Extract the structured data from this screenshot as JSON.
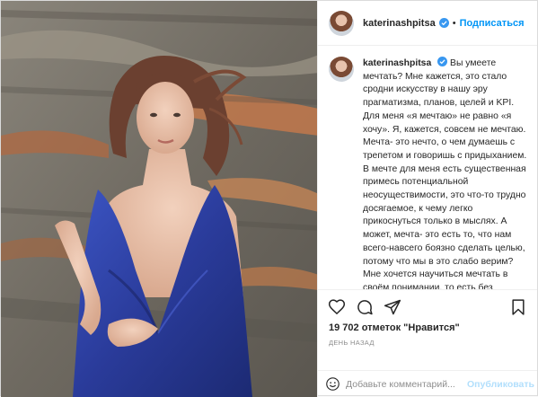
{
  "post": {
    "author": {
      "username": "katerinashpitsa",
      "verified": true,
      "follow_label": "Подписаться",
      "separator": "•"
    },
    "caption": {
      "text_lines": [
        "Вы умеете мечтать? Мне кажется, это стало сродни искусству в нашу эру прагматизма, планов, целей и KPI.",
        "Для меня «я мечтаю» не равно «я хочу». Я, кажется, совсем не мечтаю.",
        "Мечта- это нечто, о чем думаешь с трепетом и говоришь с придыханием. В мечте для меня есть существенная примесь потенциальной неосуществимости, это что-то трудно досягаемое, к чему легко прикоснуться только в мыслях. А может, мечта- это есть то, что нам всего-навсего боязно сделать целью, потому что мы в это слабо верим?",
        "Мне хочется научиться мечтать в своём понимании, то есть без прагматизма, целеполагания..."
      ]
    },
    "actions": {
      "icons": [
        "heart-icon",
        "comment-icon",
        "share-icon",
        "bookmark-icon"
      ]
    },
    "likes": {
      "count": "19 702",
      "text": "отметок \"Нравится\""
    },
    "timestamp": "День назад",
    "comment_box": {
      "placeholder": "Добавьте комментарий...",
      "publish_label": "Опубликовать"
    }
  },
  "colors": {
    "accent": "#0095f6",
    "publish_disabled": "#b2dffc",
    "dress": "#2b3f9c"
  }
}
